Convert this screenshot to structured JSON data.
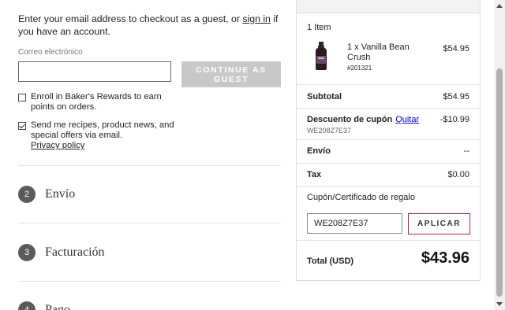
{
  "guest": {
    "intro_before": "Enter your email address to checkout as a guest, or ",
    "sign_in_link": "sign in",
    "intro_after": " if you have an account.",
    "email_label": "Correo electrónico",
    "email_value": "",
    "continue_line1": "CONTINUE AS",
    "continue_line2": "GUEST",
    "rewards_label": "Enroll in Baker's Rewards to earn points on orders.",
    "rewards_checked": false,
    "newsletter_label": "Send me recipes, product news, and special offers via email.",
    "newsletter_checked": true,
    "privacy_link": "Privacy policy"
  },
  "steps": [
    {
      "num": "2",
      "title": "Envío"
    },
    {
      "num": "3",
      "title": "Facturación"
    },
    {
      "num": "4",
      "title": "Pago"
    }
  ],
  "summary": {
    "items_count": "1 Item",
    "product": {
      "name": "1 x Vanilla Bean Crush",
      "sku": "#201321",
      "price": "$54.95"
    },
    "subtotal_label": "Subtotal",
    "subtotal_value": "$54.95",
    "discount_label": "Descuento de cupón",
    "discount_remove": "Quitar",
    "discount_code": "WE208Z7E37",
    "discount_value": "-$10.99",
    "shipping_label": "Envío",
    "shipping_value": "--",
    "tax_label": "Tax",
    "tax_value": "$0.00",
    "coupon_label": "Cupón/Certificado de regalo",
    "coupon_value": "WE208Z7E37",
    "apply_label": "APLICAR",
    "total_label": "Total (USD)",
    "total_value": "$43.96"
  },
  "colors": {
    "accent_border": "#b5294b",
    "disabled_button": "#c8c8c8",
    "step_circle": "#5a5a5a"
  }
}
